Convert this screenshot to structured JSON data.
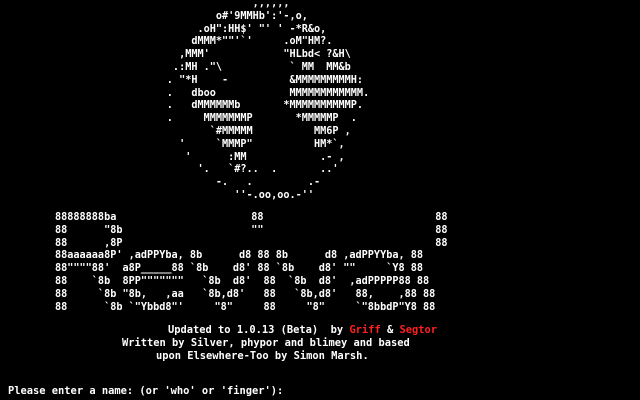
{
  "accent_colors": {
    "text": "#ffffff",
    "background": "#000000",
    "highlight": "#ff2020"
  },
  "globe_art": [
    "                    ,,,,,,",
    "              o#'9MMHb':'-,o,",
    "           .oH\":HH$' \"' ' -*R&o,",
    "          dMMM*\"\"'`'     .oM\"HM?.",
    "        ,MMM'            \"HLbd< ?&H\\",
    "       .:MH .\"\\           ` MM  MM&b",
    "      . \"*H    -          &MMMMMMMMMH:",
    "      .   dboo            MMMMMMMMMMMM.",
    "      .   dMMMMMMb       *MMMMMMMMMMP.",
    "      .     MMMMMMMP       *MMMMMP  .",
    "             `#MMMMM          MM6P ,",
    "        '     `MMMP\"          HM*`,",
    "         '      :MM            .- ,",
    "           '.   `#?..  .       ..'",
    "              -.   .         .-",
    "                 ''-.oo,oo.-''"
  ],
  "banner_art": [
    "88888888ba                      88                            88",
    "88      \"8b                     \"\"                            88",
    "88      ,8P                                                   88",
    "88aaaaaa8P' ,adPPYba, 8b      d8 88 8b      d8 ,adPPYYba, 88",
    "88\"\"\"\"88'  a8P_____88 `8b    d8' 88 `8b    d8' \"\"     `Y8 88",
    "88    `8b  8PP\"\"\"\"\"\"\"   `8b  d8'  88  `8b  d8'  ,adPPPPP88 88",
    "88     `8b \"8b,   ,aa   `8b,d8'   88   `8b,d8'   88,    ,88 88",
    "88      `8b `\"Ybbd8\"'     \"8\"     88     \"8\"     `\"8bbdP\"Y8 88"
  ],
  "credits": {
    "updated_prefix": "Updated to 1.0.13 (Beta)  by ",
    "author1": "Griff",
    "amp": " & ",
    "author2": "Segtor",
    "line2": "Written by Silver, phypor and blimey and based",
    "line3": "upon Elsewhere-Too by Simon Marsh."
  },
  "prompt": "Please enter a name: (or 'who' or 'finger'):"
}
